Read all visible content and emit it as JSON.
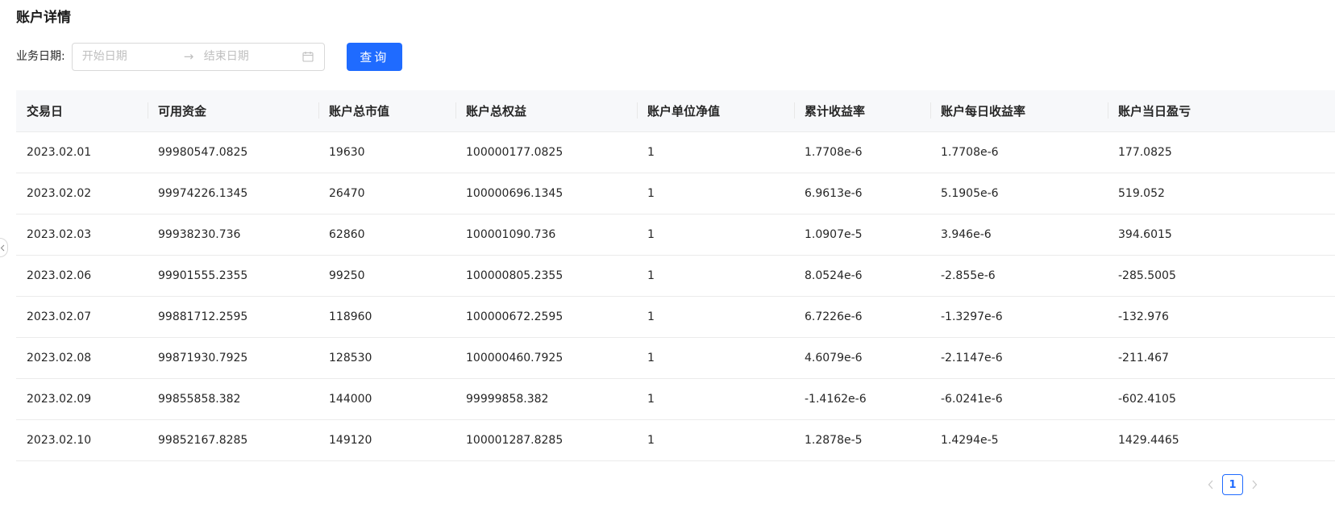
{
  "page": {
    "title": "账户详情"
  },
  "filter": {
    "label": "业务日期:",
    "start_placeholder": "开始日期",
    "separator": "→",
    "end_placeholder": "结束日期",
    "calendar_icon": "calendar-icon",
    "query_label": "查询"
  },
  "table": {
    "columns": [
      "交易日",
      "可用资金",
      "账户总市值",
      "账户总权益",
      "账户单位净值",
      "累计收益率",
      "账户每日收益率",
      "账户当日盈亏"
    ],
    "rows": [
      [
        "2023.02.01",
        "99980547.0825",
        "19630",
        "100000177.0825",
        "1",
        "1.7708e-6",
        "1.7708e-6",
        "177.0825"
      ],
      [
        "2023.02.02",
        "99974226.1345",
        "26470",
        "100000696.1345",
        "1",
        "6.9613e-6",
        "5.1905e-6",
        "519.052"
      ],
      [
        "2023.02.03",
        "99938230.736",
        "62860",
        "100001090.736",
        "1",
        "1.0907e-5",
        "3.946e-6",
        "394.6015"
      ],
      [
        "2023.02.06",
        "99901555.2355",
        "99250",
        "100000805.2355",
        "1",
        "8.0524e-6",
        "-2.855e-6",
        "-285.5005"
      ],
      [
        "2023.02.07",
        "99881712.2595",
        "118960",
        "100000672.2595",
        "1",
        "6.7226e-6",
        "-1.3297e-6",
        "-132.976"
      ],
      [
        "2023.02.08",
        "99871930.7925",
        "128530",
        "100000460.7925",
        "1",
        "4.6079e-6",
        "-2.1147e-6",
        "-211.467"
      ],
      [
        "2023.02.09",
        "99855858.382",
        "144000",
        "99999858.382",
        "1",
        "-1.4162e-6",
        "-6.0241e-6",
        "-602.4105"
      ],
      [
        "2023.02.10",
        "99852167.8285",
        "149120",
        "100001287.8285",
        "1",
        "1.2878e-5",
        "1.4294e-5",
        "1429.4465"
      ]
    ]
  },
  "pagination": {
    "current_page": "1",
    "prev_icon": "chevron-left-icon",
    "next_icon": "chevron-right-icon"
  },
  "colors": {
    "primary": "#1f6bff",
    "header_bg": "#f7f8fa",
    "border": "#ebebeb",
    "placeholder": "#bfbfbf"
  }
}
